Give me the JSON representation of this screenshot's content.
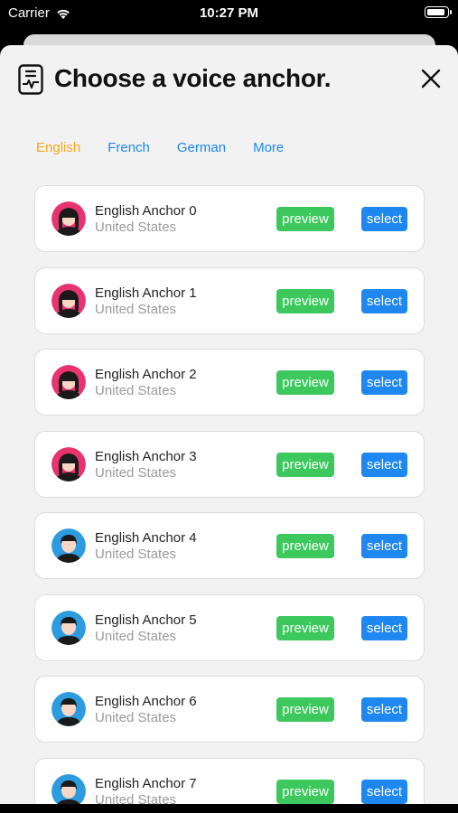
{
  "status_bar": {
    "carrier": "Carrier",
    "time": "10:27 PM"
  },
  "header": {
    "title": "Choose a voice anchor."
  },
  "tabs": [
    {
      "label": "English",
      "active": true
    },
    {
      "label": "French",
      "active": false
    },
    {
      "label": "German",
      "active": false
    },
    {
      "label": "More",
      "active": false
    }
  ],
  "anchors": [
    {
      "name": "English Anchor 0",
      "country": "United States",
      "avatar": "female",
      "preview_label": "preview",
      "select_label": "select"
    },
    {
      "name": "English Anchor 1",
      "country": "United States",
      "avatar": "female",
      "preview_label": "preview",
      "select_label": "select"
    },
    {
      "name": "English Anchor 2",
      "country": "United States",
      "avatar": "female",
      "preview_label": "preview",
      "select_label": "select"
    },
    {
      "name": "English Anchor 3",
      "country": "United States",
      "avatar": "female",
      "preview_label": "preview",
      "select_label": "select"
    },
    {
      "name": "English Anchor 4",
      "country": "United States",
      "avatar": "male",
      "preview_label": "preview",
      "select_label": "select"
    },
    {
      "name": "English Anchor 5",
      "country": "United States",
      "avatar": "male",
      "preview_label": "preview",
      "select_label": "select"
    },
    {
      "name": "English Anchor 6",
      "country": "United States",
      "avatar": "male",
      "preview_label": "preview",
      "select_label": "select"
    },
    {
      "name": "English Anchor 7",
      "country": "United States",
      "avatar": "male",
      "preview_label": "preview",
      "select_label": "select"
    }
  ],
  "colors": {
    "active_tab": "#f5a623",
    "tab": "#1e87f0",
    "preview": "#3cc85d",
    "select": "#1e87f0",
    "female_avatar_bg": "#e8336f",
    "male_avatar_bg": "#2d9be0"
  },
  "icons": {
    "header": "voice-document-icon",
    "close": "close-icon",
    "wifi": "wifi-icon",
    "battery": "battery-icon"
  }
}
